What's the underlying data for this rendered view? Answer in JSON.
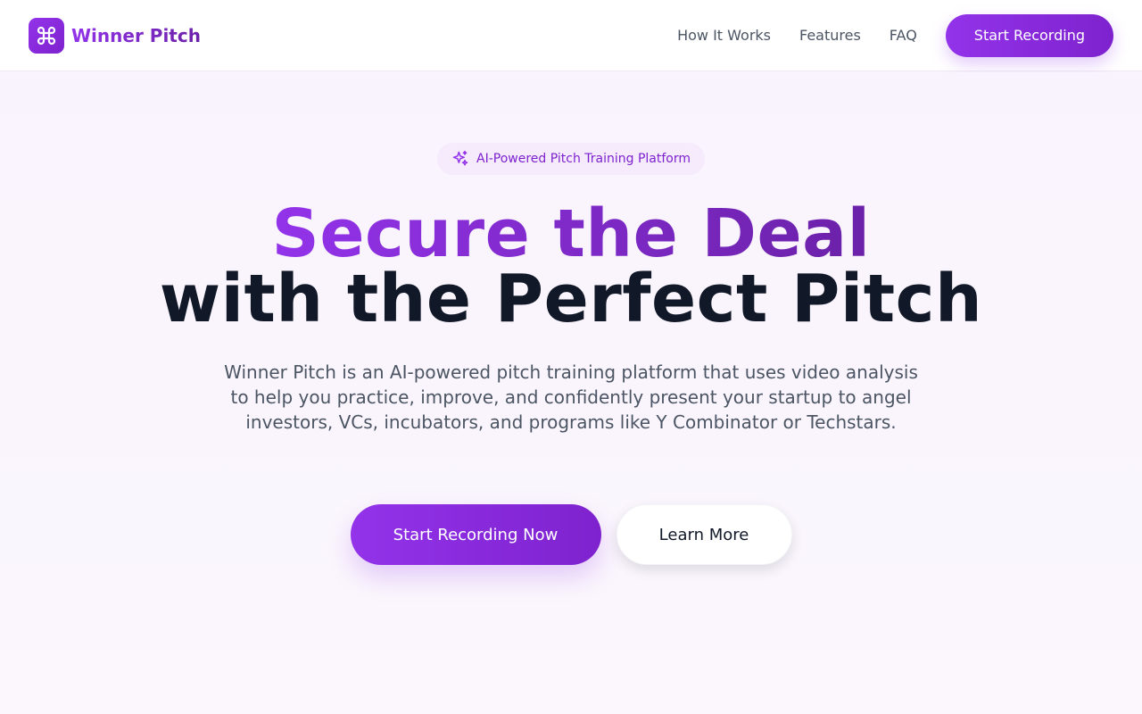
{
  "brand": {
    "name": "Winner Pitch",
    "logo_icon": "command-icon",
    "colors": {
      "accent": "#9333ea",
      "accent_dark": "#7e22ce",
      "heading_dark": "#111827"
    }
  },
  "nav": {
    "links": [
      {
        "label": "How It Works"
      },
      {
        "label": "Features"
      },
      {
        "label": "FAQ"
      }
    ],
    "cta_label": "Start Recording"
  },
  "hero": {
    "badge": {
      "icon": "sparkles-icon",
      "text": "AI-Powered Pitch Training Platform"
    },
    "headline_line1": "Secure the Deal",
    "headline_line2": "with the Perfect Pitch",
    "description": "Winner Pitch is an AI-powered pitch training platform that uses video analysis to help you practice, improve, and confidently present your startup to angel investors, VCs, incubators, and programs like Y Combinator or Techstars.",
    "primary_cta": "Start Recording Now",
    "secondary_cta": "Learn More"
  }
}
